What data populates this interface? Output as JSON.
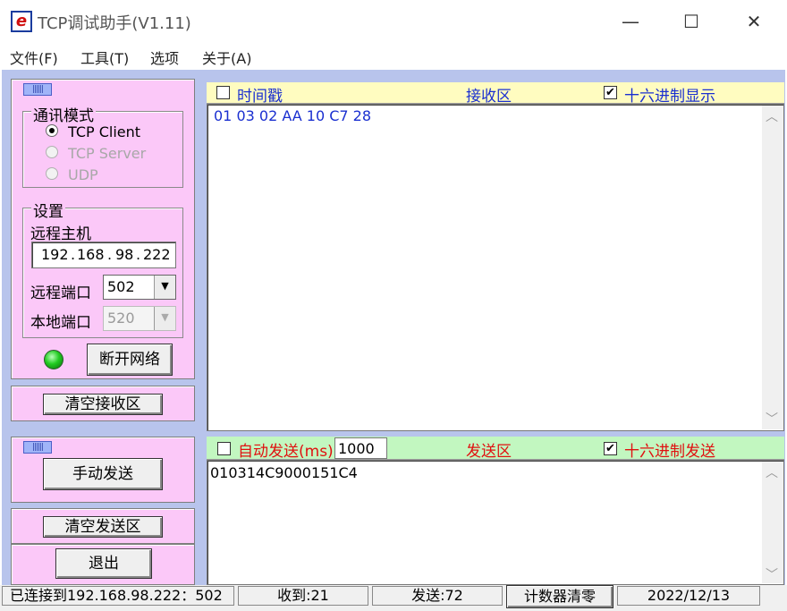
{
  "window": {
    "title": "TCP调试助手(V1.11)",
    "app_icon_glyph": "e",
    "minimize_glyph": "—",
    "maximize_glyph": "☐",
    "close_glyph": "✕"
  },
  "menu": [
    "文件(F)",
    "工具(T)",
    "选项",
    "关于(A)"
  ],
  "left_panel": {
    "tab_glyph": "||||||",
    "mode_group": {
      "title": "通讯模式",
      "options": [
        {
          "label": "TCP Client",
          "selected": true,
          "enabled": true
        },
        {
          "label": "TCP Server",
          "selected": false,
          "enabled": false
        },
        {
          "label": "UDP",
          "selected": false,
          "enabled": false
        }
      ]
    },
    "settings_group": {
      "title": "设置",
      "remote_host_label": "远程主机",
      "remote_host_ip": [
        "192",
        "168",
        "98",
        "222"
      ],
      "remote_port_label": "远程端口",
      "remote_port_value": "502",
      "local_port_label": "本地端口",
      "local_port_value": "520"
    },
    "status_led_color": "#22cc22",
    "disconnect_button": "断开网络",
    "clear_receive_button": "清空接收区",
    "manual_send_button": "手动发送",
    "clear_send_button": "清空发送区",
    "exit_button": "退出"
  },
  "receive": {
    "timestamp_label": "时间戳",
    "timestamp_checked": false,
    "area_label": "接收区",
    "hex_display_label": "十六进制显示",
    "hex_display_checked": true,
    "content": "01 03 02 AA 10 C7 28"
  },
  "send": {
    "auto_send_label": "自动发送(ms)",
    "auto_send_checked": false,
    "interval_value": "1000",
    "area_label": "发送区",
    "hex_send_label": "十六进制发送",
    "hex_send_checked": true,
    "content": "010314C9000151C4"
  },
  "status_bar": {
    "connection": "已连接到192.168.98.222：502",
    "received": "收到:21",
    "sent": "发送:72",
    "reset_counter_button": "计数器清零",
    "date": "2022/12/13"
  },
  "colors": {
    "client_bg": "#b8c4ec",
    "panel_bg": "#fbc8f8",
    "receive_header_bg": "#fffcc0",
    "send_header_bg": "#c2f7c0",
    "receive_text": "#1a2fd0",
    "send_header_text": "#e01010"
  }
}
